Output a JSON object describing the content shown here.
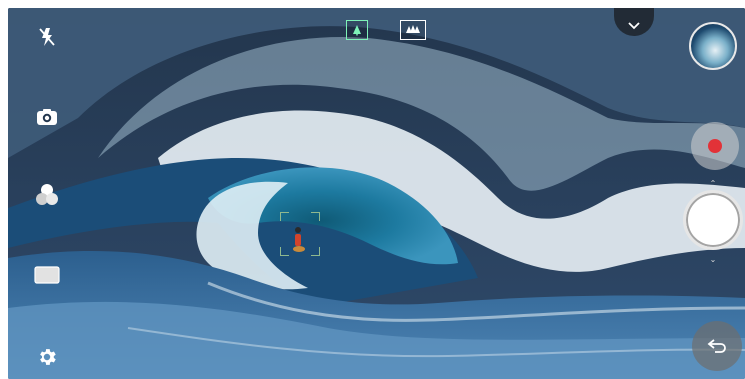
{
  "app": {
    "name": "",
    "mode": "photo"
  },
  "top_bar": {
    "mode_toggles": [
      {
        "icon": "single-tree-icon",
        "active": true
      },
      {
        "icon": "multi-tree-icon",
        "active": false
      }
    ],
    "dropdown_icon": "chevron-down-icon"
  },
  "left_rail": {
    "items": [
      {
        "icon": "flash-off-icon"
      },
      {
        "icon": "switch-camera-icon"
      },
      {
        "icon": "filter-icon"
      },
      {
        "icon": "aspect-ratio-icon"
      },
      {
        "icon": "settings-gear-icon"
      }
    ]
  },
  "right_rail": {
    "gallery_thumbnail": "gallery-thumbnail",
    "record_icon": "record-icon",
    "shutter_icon": "shutter-icon",
    "back_icon": "back-arrow-icon"
  },
  "viewfinder": {
    "focus_indicator": true
  },
  "colors": {
    "record_red": "#e23238",
    "active_toggle": "#7ef2b8",
    "focus_green": "#8fb98f"
  }
}
